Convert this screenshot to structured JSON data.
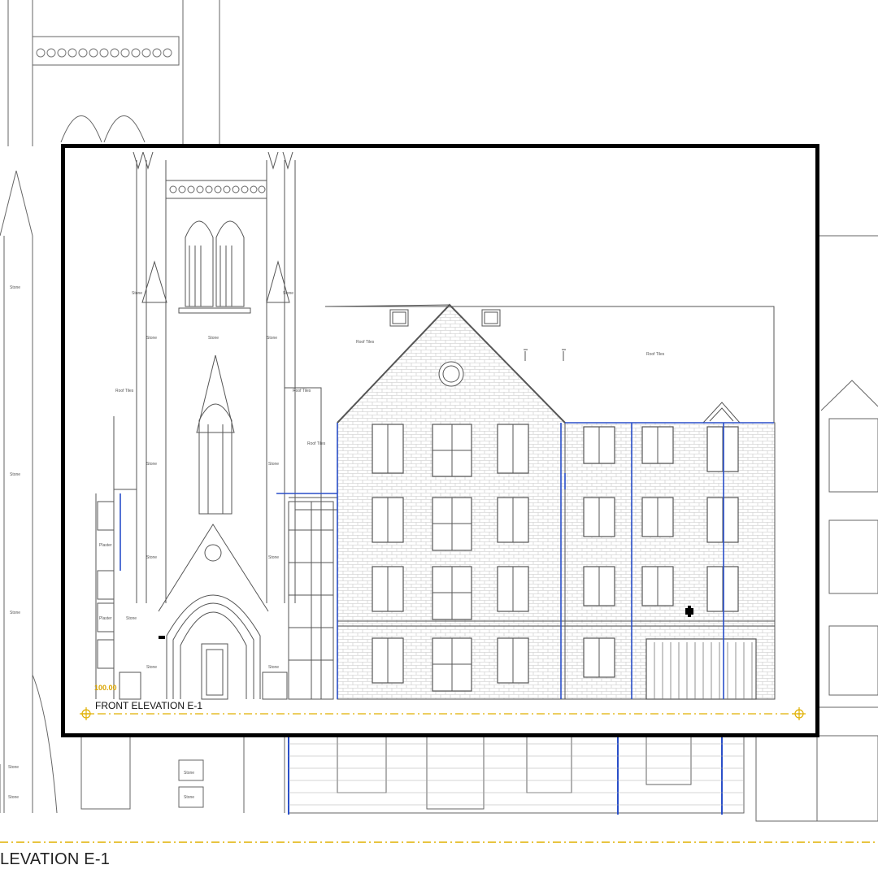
{
  "drawing": {
    "title": "FRONT ELEVATION E-1",
    "background_title": "LEVATION E-1",
    "level_marker": "100.00"
  },
  "material_labels": {
    "stone": "Stone",
    "roof_tiles": "Roof Tiles",
    "plaster": "Plaster"
  },
  "colors": {
    "line": "#555555",
    "pipe": "#2a4fc9",
    "level_line": "#e0b000",
    "frame": "#000000"
  }
}
